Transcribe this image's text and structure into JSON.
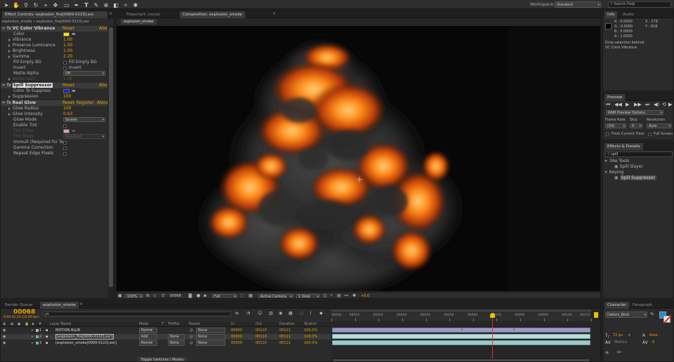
{
  "workspace": {
    "label": "Workspace:",
    "value": "Standard",
    "search": "Search Help"
  },
  "effect_controls": {
    "tab": "Effect Controls: explosion_fire[0000-0110].exr",
    "breadcrumb": "explosion_smoke • explosion_fire[0000-0110].exr",
    "effects": [
      {
        "fx": "fx",
        "name": "VC Color Vibrance",
        "reset": "Reset",
        "about": "Abo"
      },
      {
        "fx": "fx",
        "name": "Spill Suppressor",
        "reset": "Reset",
        "about": "Abo"
      },
      {
        "fx": "fx",
        "name": "Real Glow",
        "reset": "Reset",
        "register": "Register",
        "about": "About"
      }
    ],
    "vibrance_props": [
      {
        "label": "Color"
      },
      {
        "label": "Vibrance",
        "value": "1.00"
      },
      {
        "label": "Preserve Luminance",
        "value": "1.00"
      },
      {
        "label": "Brightness",
        "value": "1.00"
      },
      {
        "label": "Gamma",
        "value": "2.20"
      },
      {
        "label": "Fill Empty BG",
        "check": "Fill Empty BG"
      },
      {
        "label": "Invert",
        "check": "Invert"
      },
      {
        "label": "Matte Alpha",
        "dropdown": "Off"
      },
      {
        "label": "Alpha Gain",
        "value": "1.00"
      }
    ],
    "spill_props": [
      {
        "label": "Color To Suppress"
      },
      {
        "label": "Suppression",
        "value": "100"
      }
    ],
    "glow_props": [
      {
        "label": "Glow Radius",
        "value": "100"
      },
      {
        "label": "Glow Intensity",
        "value": "0.63"
      },
      {
        "label": "Glow Mode",
        "dropdown": "Screen"
      },
      {
        "label": "Enable Tint"
      },
      {
        "label": "Tint Color"
      },
      {
        "label": "Tint Mode",
        "dropdown": "Standard"
      },
      {
        "label": "Unmult (Required for Te"
      },
      {
        "label": "Gamma Correction"
      },
      {
        "label": "Repeat Edge Pixels"
      }
    ],
    "colors": {
      "vibrance_color": "#f5e400",
      "suppress_color": "#1e22d6",
      "tint_color": "#e8a0a0"
    }
  },
  "viewer": {
    "tabs": [
      "Flowchart: (none)",
      "Composition: explosion_smoke"
    ],
    "comp_tab": "explosion_smoke",
    "footer": {
      "zoom": "100%",
      "time": "00068",
      "resolution": "Full",
      "camera": "Active Camera",
      "views": "1 View",
      "exposure": "+0.0"
    }
  },
  "info": {
    "tabs": [
      "Info",
      "Audio"
    ],
    "values": [
      "R : 0.0000",
      "G : 0.0000",
      "B : 0.0000",
      "A : 1.0000"
    ],
    "coords": [
      "X : 279",
      "Y : 818"
    ],
    "message": [
      "Drop selection behind:",
      "VC Color Vibrance"
    ]
  },
  "preview": {
    "tab": "Preview",
    "options": "RAM Preview Options",
    "labels": {
      "frame_rate": "Frame Rate",
      "skip": "Skip",
      "resolution": "Resolution"
    },
    "values": {
      "frame_rate": "(24)",
      "skip": "0",
      "resolution": "Auto"
    },
    "from_current": "From Current Time",
    "full_screen": "Full Screen"
  },
  "effects_presets": {
    "tab": "Effects & Presets",
    "search": "spill",
    "tree": [
      {
        "label": "3Ae Tools",
        "children": [
          "Spill Slayer"
        ]
      },
      {
        "label": "Keying",
        "children": [
          "Spill Suppressor"
        ]
      }
    ]
  },
  "timeline": {
    "tabs": [
      "Render Queue",
      "explosion_smoke"
    ],
    "timecode": "00068",
    "sub_timecode": "0:00:02:20 (24.00 fps)",
    "search_placeholder": "ρ▾",
    "columns": [
      "#",
      "Layer Name",
      "Mode",
      "T",
      "TrkMat",
      "Parent",
      "In",
      "Out",
      "Duration",
      "Stretch"
    ],
    "layers": [
      {
        "num": "1",
        "name": "MOTION BLUR",
        "mode": "Norm▾",
        "trkmat": "",
        "parent": "None",
        "in": "00000",
        "out": "00110",
        "duration": "00111",
        "stretch": "100.0%",
        "color": "#e0e0e0"
      },
      {
        "num": "2",
        "name": "[explosion_fire[0000-0110].exr]",
        "mode": "Add",
        "trkmat": "None",
        "parent": "None",
        "in": "00000",
        "out": "00110",
        "duration": "00111",
        "stretch": "100.0%",
        "color": "#7ec6c6"
      },
      {
        "num": "3",
        "name": "[explosion_smoke[0000-0110].exr]",
        "mode": "Norm▾",
        "trkmat": "None",
        "parent": "None",
        "in": "00000",
        "out": "00110",
        "duration": "00111",
        "stretch": "100.0%",
        "color": "#7ec6c6"
      }
    ],
    "ruler": [
      "00000",
      "00010",
      "00020",
      "00030",
      "00040",
      "00050",
      "00060",
      "00070",
      "00080",
      "00090",
      "00100",
      "00110"
    ],
    "toggle_label": "Toggle Switches / Modes",
    "playhead_frame": 68,
    "total_frames": 110
  },
  "character": {
    "tabs": [
      "Character",
      "Paragraph"
    ],
    "font": "Dekers_Bold",
    "size": "72 px",
    "leading": "Auto",
    "tracking_label": "Metrics",
    "tracking": "0",
    "stroke": "px"
  }
}
